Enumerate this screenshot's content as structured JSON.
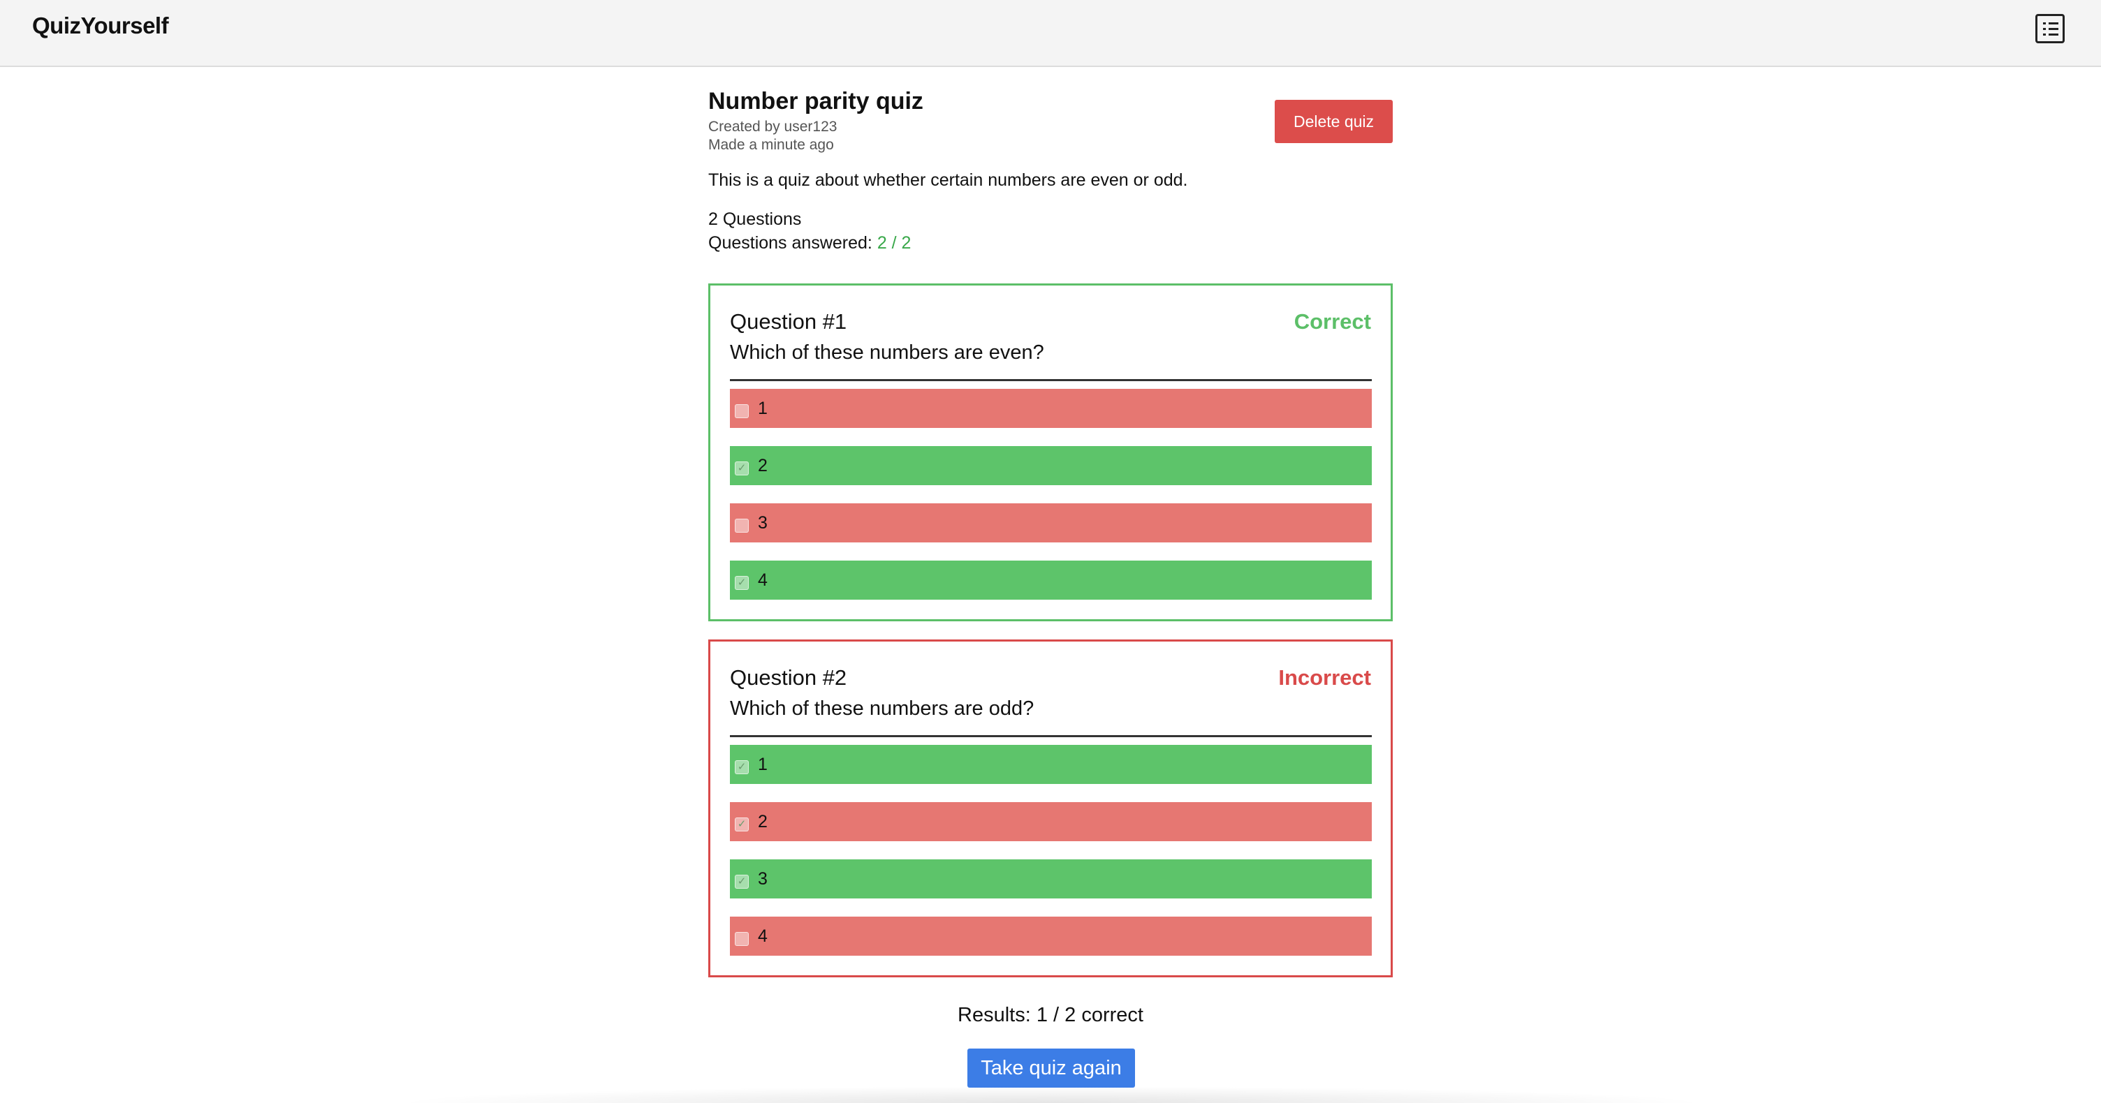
{
  "header": {
    "brand": "QuizYourself",
    "menu_icon": "list-icon"
  },
  "quiz": {
    "title": "Number parity quiz",
    "created_by": "Created by user123",
    "made": "Made a minute ago",
    "delete_label": "Delete quiz",
    "description": "This is a quiz about whether certain numbers are even or odd.",
    "question_count": "2 Questions",
    "answered_label": "Questions answered:",
    "answered_value": "2 / 2"
  },
  "questions": [
    {
      "label": "Question #1",
      "status": "Correct",
      "text": "Which of these numbers are even?",
      "options": [
        {
          "label": "1",
          "checked": false,
          "state": "incorrect"
        },
        {
          "label": "2",
          "checked": true,
          "state": "correct"
        },
        {
          "label": "3",
          "checked": false,
          "state": "incorrect"
        },
        {
          "label": "4",
          "checked": true,
          "state": "correct"
        }
      ]
    },
    {
      "label": "Question #2",
      "status": "Incorrect",
      "text": "Which of these numbers are odd?",
      "options": [
        {
          "label": "1",
          "checked": true,
          "state": "correct"
        },
        {
          "label": "2",
          "checked": true,
          "state": "incorrect"
        },
        {
          "label": "3",
          "checked": true,
          "state": "correct"
        },
        {
          "label": "4",
          "checked": false,
          "state": "incorrect"
        }
      ]
    }
  ],
  "results": {
    "text": "Results: 1 / 2 correct",
    "retake_label": "Take quiz again"
  },
  "colors": {
    "correct": "#5dc46a",
    "incorrect": "#e67772",
    "delete": "#dc4d4b",
    "primary": "#3c7de6"
  }
}
